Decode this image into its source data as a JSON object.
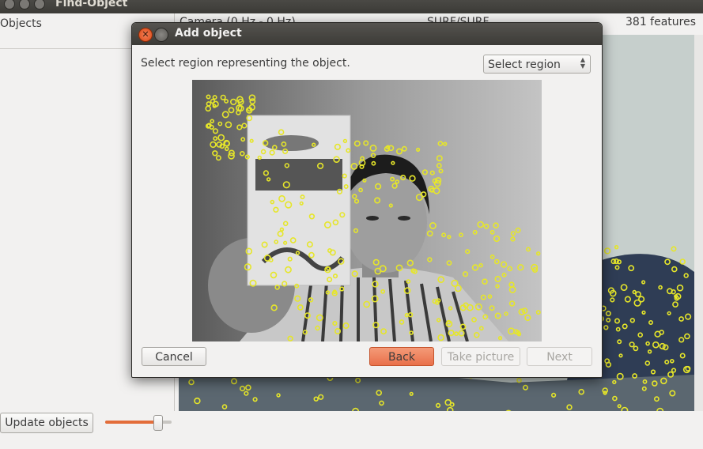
{
  "window": {
    "title": "Find-Object"
  },
  "objects_panel": {
    "header": "Objects",
    "update_button": "Update objects",
    "slider_value": 0.78
  },
  "camera_header": {
    "label": "Camera (0 Hz - 0 Hz)",
    "detector": "SURF/SURF",
    "features": "381 features"
  },
  "dialog": {
    "title": "Add object",
    "instruction": "Select region representing the object.",
    "region_select": {
      "value": "Select region"
    },
    "buttons": {
      "cancel": "Cancel",
      "back": "Back",
      "take_picture": "Take picture",
      "next": "Next"
    }
  },
  "colors": {
    "accent": "#e9704a",
    "keypoint": "#e6e62a",
    "titlebar": "#3c3b37"
  }
}
